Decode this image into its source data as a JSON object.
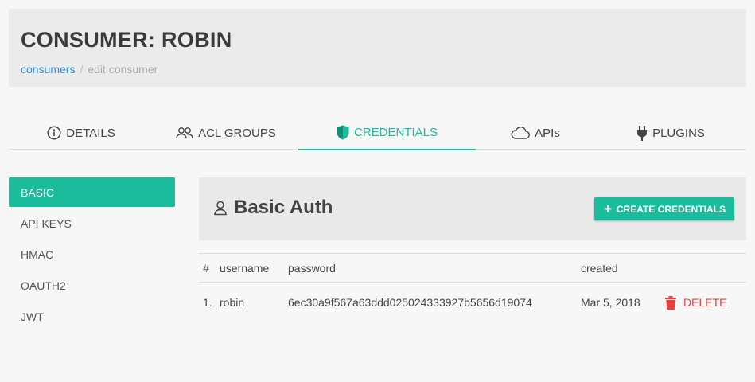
{
  "header": {
    "title": "CONSUMER: ROBIN",
    "breadcrumb": {
      "link": "consumers",
      "separator": "/",
      "current": "edit consumer"
    }
  },
  "tabs": [
    {
      "label": "DETAILS",
      "icon": "info-circle-icon"
    },
    {
      "label": "ACL GROUPS",
      "icon": "users-icon"
    },
    {
      "label": "CREDENTIALS",
      "icon": "shield-icon",
      "active": true
    },
    {
      "label": "APIs",
      "icon": "cloud-icon"
    },
    {
      "label": "PLUGINS",
      "icon": "plug-icon"
    }
  ],
  "sidebar": {
    "items": [
      {
        "label": "BASIC",
        "active": true
      },
      {
        "label": "API KEYS"
      },
      {
        "label": "HMAC"
      },
      {
        "label": "OAUTH2"
      },
      {
        "label": "JWT"
      }
    ]
  },
  "panel": {
    "title": "Basic Auth",
    "title_icon": "user-icon",
    "create_button": {
      "icon": "plus-icon",
      "label": "CREATE CREDENTIALS"
    }
  },
  "table": {
    "headers": {
      "num": "#",
      "username": "username",
      "password": "password",
      "created": "created"
    },
    "rows": [
      {
        "num": "1.",
        "username": "robin",
        "password": "6ec30a9f567a63ddd025024333927b5656d19074",
        "created": "Mar 5, 2018",
        "action": "DELETE",
        "action_icon": "trash-icon"
      }
    ]
  },
  "colors": {
    "accent": "#1abc9c",
    "link": "#2e8fd8",
    "danger": "#e8413f"
  }
}
